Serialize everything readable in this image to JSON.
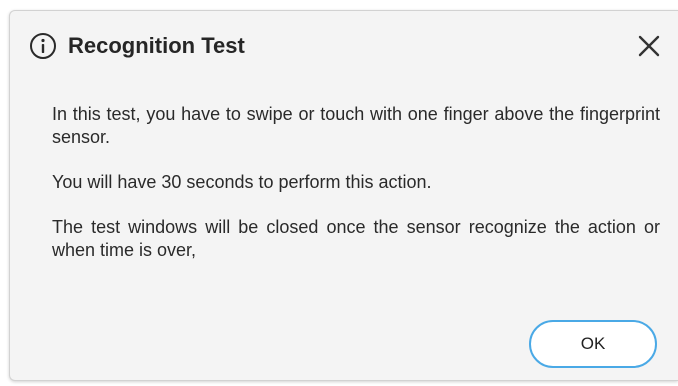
{
  "dialog": {
    "title": "Recognition Test",
    "icon": "info-icon",
    "close_icon": "close-icon",
    "paragraphs": [
      "In this test, you have to swipe or touch with one finger above the fingerprint sensor.",
      "You will have 30 seconds to perform this action.",
      "The test windows will be closed once the sensor recognize the action or when time is over,"
    ],
    "ok_label": "OK"
  },
  "colors": {
    "dialog_background": "#f4f4f4",
    "accent_border": "#4aa9e6",
    "text": "#2a2a2a"
  }
}
